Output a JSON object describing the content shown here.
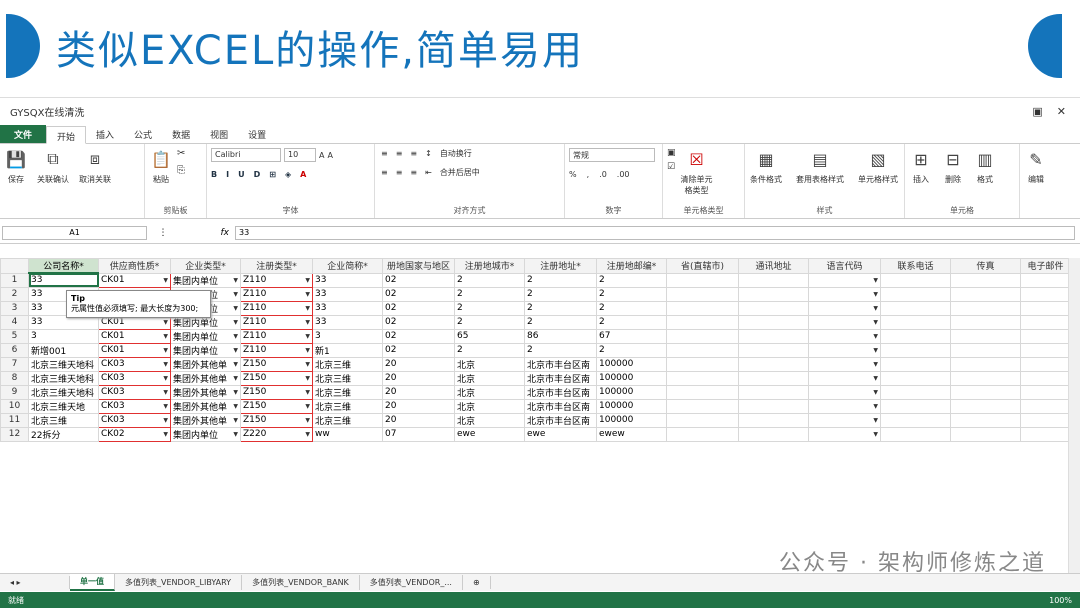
{
  "banner": {
    "title": "类似EXCEL的操作,简单易用"
  },
  "window": {
    "title": "GYSQX在线清洗",
    "restore": "▣",
    "close": "✕"
  },
  "tabs": [
    "文件",
    "开始",
    "插入",
    "公式",
    "数据",
    "视图",
    "设置"
  ],
  "ribbon": {
    "save": "保存",
    "link_confirm": "关联确认",
    "cancel_link": "取消关联",
    "paste": "粘贴",
    "clipboard": "剪贴板",
    "font_name": "Calibri",
    "font_size": "10",
    "font_group": "字体",
    "wrap": "自动换行",
    "merge": "合并后居中",
    "align_group": "对齐方式",
    "num_format": "常规",
    "num_group": "数字",
    "clear_type": "清除单元格类型",
    "cell_type_group": "单元格类型",
    "cond_format": "条件格式",
    "table_style": "套用表格样式",
    "cell_style": "单元格样式",
    "style_group": "样式",
    "insert": "插入",
    "delete": "删除",
    "format": "格式",
    "cells_group": "单元格",
    "edit": "编辑"
  },
  "formula": {
    "cell": "A1",
    "fx": "fx",
    "value": "33"
  },
  "columns": [
    "公司名称*",
    "供应商性质*",
    "企业类型*",
    "注册类型*",
    "企业简称*",
    "册地国家与地区",
    "注册地城市*",
    "注册地址*",
    "注册地邮编*",
    "省(直辖市)",
    "通讯地址",
    "语言代码",
    "联系电话",
    "传真",
    "电子邮件"
  ],
  "rows": [
    [
      "1",
      "33",
      "CK01",
      "集团内单位",
      "Z110",
      "33",
      "02",
      "2",
      "2",
      "2"
    ],
    [
      "2",
      "33",
      "",
      "集团内单位",
      "Z110",
      "33",
      "02",
      "2",
      "2",
      "2"
    ],
    [
      "3",
      "33",
      "",
      "集团内单位",
      "Z110",
      "33",
      "02",
      "2",
      "2",
      "2"
    ],
    [
      "4",
      "33",
      "CK01",
      "集团内单位",
      "Z110",
      "33",
      "02",
      "2",
      "2",
      "2"
    ],
    [
      "5",
      "3",
      "CK01",
      "集团内单位",
      "Z110",
      "3",
      "02",
      "65",
      "86",
      "67"
    ],
    [
      "6",
      "新增001",
      "CK01",
      "集团内单位",
      "Z110",
      "新1",
      "02",
      "2",
      "2",
      "2"
    ],
    [
      "7",
      "北京三维天地科",
      "CK03",
      "集团外其他单",
      "Z150",
      "北京三维",
      "20",
      "北京",
      "北京市丰台区南",
      "100000"
    ],
    [
      "8",
      "北京三维天地科",
      "CK03",
      "集团外其他单",
      "Z150",
      "北京三维",
      "20",
      "北京",
      "北京市丰台区南",
      "100000"
    ],
    [
      "9",
      "北京三维天地科",
      "CK03",
      "集团外其他单",
      "Z150",
      "北京三维",
      "20",
      "北京",
      "北京市丰台区南",
      "100000"
    ],
    [
      "10",
      "北京三维天地",
      "CK03",
      "集团外其他单",
      "Z150",
      "北京三维",
      "20",
      "北京",
      "北京市丰台区南",
      "100000"
    ],
    [
      "11",
      "北京三维",
      "CK03",
      "集团外其他单",
      "Z150",
      "北京三维",
      "20",
      "北京",
      "北京市丰台区南",
      "100000"
    ],
    [
      "12",
      "22拆分",
      "CK02",
      "集团内单位",
      "Z220",
      "ww",
      "07",
      "ewe",
      "ewe",
      "ewew"
    ]
  ],
  "tip": {
    "title": "Tip",
    "text": "元属性值必须填写; 最大长度为300;"
  },
  "sheet_tabs": [
    "单一值",
    "多值列表_VENDOR_LIBYARY",
    "多值列表_VENDOR_BANK",
    "多值列表_VENDOR_..."
  ],
  "status": {
    "left": "就绪",
    "zoom": "100%"
  },
  "watermark": "公众号 · 架构师修炼之道"
}
